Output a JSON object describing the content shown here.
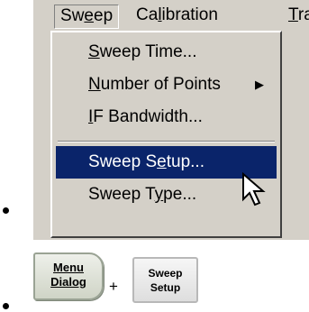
{
  "menubar": {
    "items": [
      {
        "label": "Sweep",
        "underline_index": 2
      },
      {
        "label": "Calibration",
        "underline_index": 2
      },
      {
        "label": "Tra",
        "underline_index": 0
      }
    ]
  },
  "dropdown": {
    "items": [
      {
        "label": "Sweep Time...",
        "underline_index": 0
      },
      {
        "label": "Number of Points",
        "underline_index": 0,
        "submenu": true
      },
      {
        "label": "IF Bandwidth...",
        "underline_index": 0
      },
      {
        "label": "Sweep Setup...",
        "underline_index": 7,
        "selected": true
      },
      {
        "label": "Sweep Type...",
        "underline_index": 7
      }
    ]
  },
  "keys": {
    "menu_dialog": {
      "line1": "Menu",
      "line2": "Dialog"
    },
    "plus": "+",
    "sweep_setup": {
      "line1": "Sweep",
      "line2": "Setup"
    }
  },
  "colors": {
    "menu_bg": "#d4d0c8",
    "selection_bg": "#0a246a"
  }
}
